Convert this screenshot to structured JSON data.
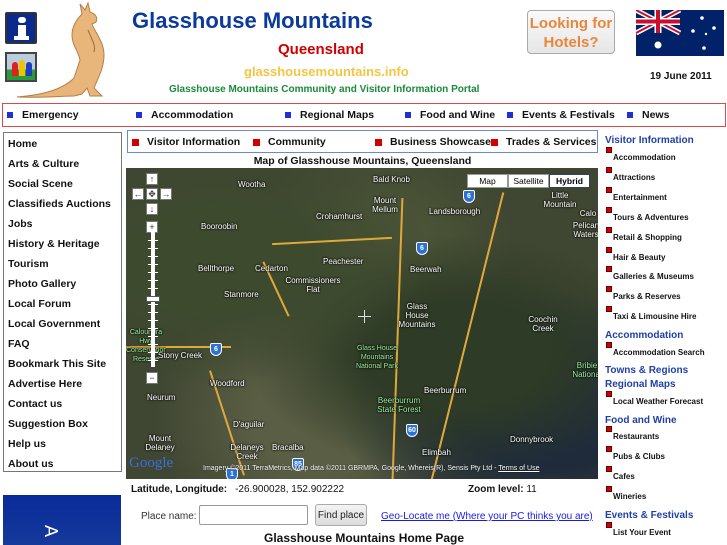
{
  "header": {
    "title": "Glasshouse Mountains",
    "region": "Queensland",
    "domain": "glasshousemountains.info",
    "tagline": "Glasshouse Mountains Community and Visitor Information Portal",
    "hotels_button": "Looking for Hotels?",
    "date": "19 June 2011"
  },
  "top_nav": [
    "Emergency",
    "Accommodation",
    "Regional Maps",
    "Food and Wine",
    "Events & Festivals",
    "News"
  ],
  "left_nav": [
    "Home",
    "Arts & Culture",
    "Social Scene",
    "Classifieds Auctions",
    "Jobs",
    "History & Heritage",
    "Tourism",
    "Photo Gallery",
    "Local Forum",
    "Local Government",
    "FAQ",
    "Bookmark This Site",
    "Advertise Here",
    "Contact us",
    "Suggestion Box",
    "Help us",
    "About us"
  ],
  "ad_box_text": "A",
  "sub_nav": [
    "Visitor Information",
    "Community",
    "Business Showcase",
    "Trades & Services"
  ],
  "map": {
    "title": "Map of Glasshouse Mountains, Queensland",
    "type_buttons": [
      "Map",
      "Satellite",
      "Hybrid"
    ],
    "active_type": "Hybrid",
    "controls": {
      "up": "↑",
      "left": "←",
      "center": "✥",
      "right": "→",
      "down": "↓",
      "zoom_in": "+",
      "zoom_out": "−"
    },
    "labels": [
      {
        "text": "Wootha"
      },
      {
        "text": "Bald Knob"
      },
      {
        "text": "Mount Mellum"
      },
      {
        "text": "Landsborough"
      },
      {
        "text": "Crohamhurst"
      },
      {
        "text": "Booroobin"
      },
      {
        "text": "Little Mountain"
      },
      {
        "text": "Pelican Waters"
      },
      {
        "text": "Peachester"
      },
      {
        "text": "Beerwah"
      },
      {
        "text": "Bellthorpe"
      },
      {
        "text": "Cedarton"
      },
      {
        "text": "Commissioners Flat"
      },
      {
        "text": "Stanmore"
      },
      {
        "text": "Glass House Mountains"
      },
      {
        "text": "Coochin Creek"
      },
      {
        "text": "Stony Creek"
      },
      {
        "text": "Woodford"
      },
      {
        "text": "Neurum"
      },
      {
        "text": "Glass House Mountains National Park"
      },
      {
        "text": "Beerburrum"
      },
      {
        "text": "Beerburrum State Forest"
      },
      {
        "text": "D'aguilar"
      },
      {
        "text": "Mount Delaney"
      },
      {
        "text": "Delaneys Creek"
      },
      {
        "text": "Bracalba"
      },
      {
        "text": "Elimbah"
      },
      {
        "text": "Donnybrook"
      },
      {
        "text": "Bribie National"
      },
      {
        "text": "Calo"
      },
      {
        "text": "Caloundra Hwy Conservation Reserve"
      }
    ],
    "shields": [
      "6",
      "6",
      "6",
      "60",
      "85",
      "1"
    ],
    "google_logo": "Google",
    "attribution": "Imagery ©2011 TerraMetrics, Map data ©2011 GBRMPA, Google, Whereis(R), Sensis Pty Ltd - ",
    "terms_link": "Terms of Use"
  },
  "location": {
    "coords_label": "Latitude, Longitude:",
    "coords_value": "-26.900028, 152.902222",
    "zoom_label": "Zoom level:",
    "zoom_value": "11",
    "place_label": "Place name:",
    "place_value": "",
    "find_button": "Find place",
    "geo_link": "Geo-Locate me (Where your PC thinks you are)"
  },
  "home_heading": "Glasshouse Mountains Home Page",
  "right_sidebar": {
    "sections": [
      {
        "heading": "Visitor Information",
        "items": [
          "Accommodation",
          "Attractions",
          "Entertainment",
          "Tours & Adventures",
          "Retail & Shopping",
          "Hair & Beauty",
          "Galleries & Museums",
          "Parks & Reserves",
          "Taxi & Limousine Hire"
        ]
      },
      {
        "heading": "Accommodation",
        "items": [
          "Accommodation Search"
        ]
      },
      {
        "heading": "Towns & Regions",
        "items": []
      },
      {
        "heading": "Regional Maps",
        "items": [
          "Local Weather Forecast"
        ]
      },
      {
        "heading": "Food and Wine",
        "items": [
          "Restaurants",
          "Pubs & Clubs",
          "Cafes",
          "Wineries"
        ]
      },
      {
        "heading": "Events & Festivals",
        "items": [
          "List Your Event"
        ]
      }
    ]
  },
  "colors": {
    "title_blue": "#0b3a9a",
    "region_red": "#d00000",
    "domain_yellow": "#f5c542",
    "tagline_green": "#1b8a3a",
    "nav_border_red": "#d94a4a",
    "sub_nav_border": "#6a8acb",
    "sidebar_heading_blue": "#1f3fa8",
    "link_blue": "#1a1ae6"
  }
}
